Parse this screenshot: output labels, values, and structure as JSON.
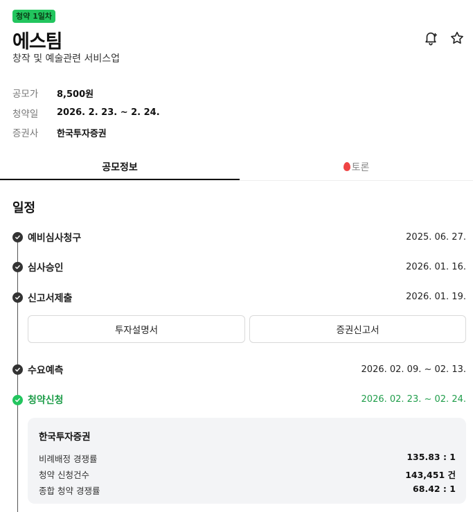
{
  "header": {
    "badge": "청약 1일차",
    "title": "에스팀",
    "subtitle": "창작 및 예술관련 서비스업",
    "icons": [
      "bell-plus-icon",
      "star-icon"
    ]
  },
  "info": [
    {
      "label": "공모가",
      "value": "8,500원"
    },
    {
      "label": "청약일",
      "value": "2026. 2. 23. ~ 2. 24."
    },
    {
      "label": "증권사",
      "value": "한국투자증권"
    }
  ],
  "tabs": {
    "offering": "공모정보",
    "discussion": "토론"
  },
  "schedule": {
    "title": "일정",
    "steps": [
      {
        "label": "예비심사청구",
        "date": "2025. 06. 27."
      },
      {
        "label": "심사승인",
        "date": "2026. 01. 16."
      },
      {
        "label": "신고서제출",
        "date": "2026. 01. 19."
      },
      {
        "label": "수요예측",
        "date": "2026. 02. 09. ~ 02. 13."
      },
      {
        "label": "청약신청",
        "date": "2026. 02. 23. ~ 02. 24."
      }
    ],
    "documents": [
      "투자설명서",
      "증권신고서"
    ],
    "active_color": "#22c55e"
  },
  "subscription": {
    "broker": "한국투자증권",
    "rows": [
      {
        "label": "비례배정 경쟁률",
        "value": "135.83 : 1"
      },
      {
        "label": "청약 신청건수",
        "value": "143,451 건"
      },
      {
        "label": "종합 청약 경쟁률",
        "value": "68.42 : 1"
      }
    ]
  }
}
